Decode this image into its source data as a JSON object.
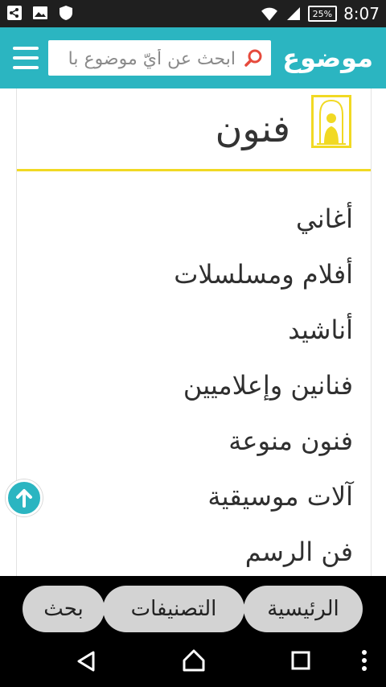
{
  "status_bar": {
    "time": "8:07",
    "battery": "25%"
  },
  "header": {
    "logo": "موضوع",
    "search_placeholder": "ابحث عن أيّ موضوع با"
  },
  "category": {
    "title": "فنون",
    "subcategories": [
      "أغاني",
      "أفلام ومسلسلات",
      "أناشيد",
      "فنانين وإعلاميين",
      "فنون منوعة",
      "آلات موسيقية",
      "فن الرسم"
    ]
  },
  "bottom_nav": {
    "home": "الرئيسية",
    "categories": "التصنيفات",
    "search": "بحث"
  },
  "colors": {
    "accent": "#2bb5c1",
    "highlight": "#f1d923"
  }
}
